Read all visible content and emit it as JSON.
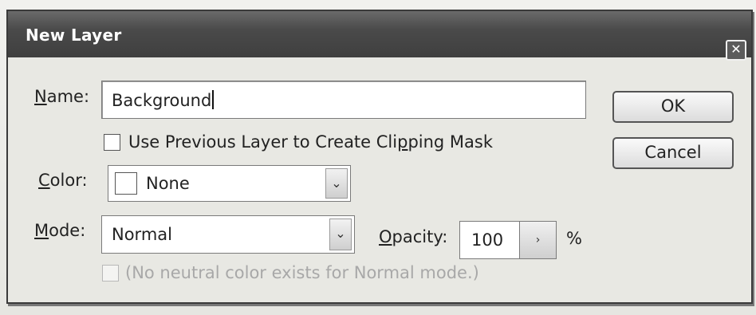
{
  "dialog": {
    "title": "New Layer",
    "close_glyph": "✕"
  },
  "name_field": {
    "label_mnemonic": "N",
    "label_rest": "ame:",
    "value": "Background"
  },
  "clipping_mask": {
    "label_before": "Use Previous Layer to Create Cli",
    "label_mnemonic": "p",
    "label_after": "ping Mask",
    "checked": false
  },
  "color_field": {
    "label_mnemonic": "C",
    "label_rest": "olor:",
    "value": "None",
    "swatch": "#ffffff",
    "arrow_icon": "chevron-down-icon"
  },
  "mode_field": {
    "label_mnemonic": "M",
    "label_rest": "ode:",
    "value": "Normal",
    "arrow_icon": "chevron-down-icon"
  },
  "opacity_field": {
    "label_mnemonic": "O",
    "label_rest": "pacity:",
    "value": "100",
    "unit": "%",
    "step_glyph": "›"
  },
  "neutral_color": {
    "label": "(No neutral color exists for Normal mode.)",
    "enabled": false
  },
  "buttons": {
    "ok": "OK",
    "cancel": "Cancel"
  }
}
